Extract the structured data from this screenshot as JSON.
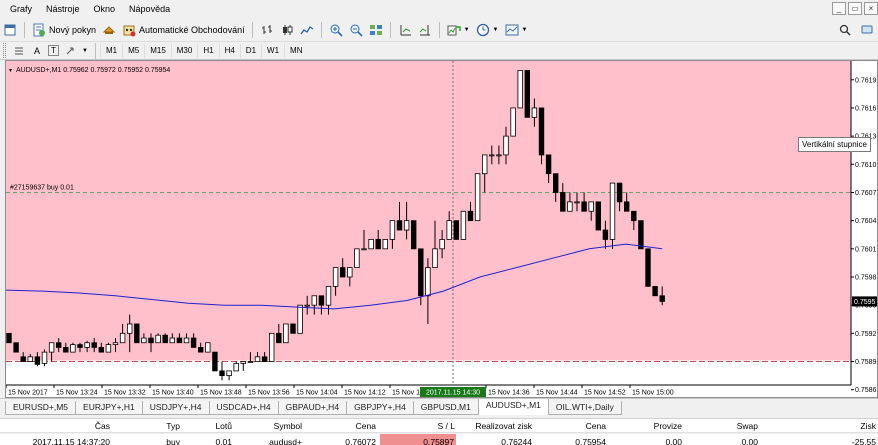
{
  "menu": [
    "Grafy",
    "Nástroje",
    "Okno",
    "Nápověda"
  ],
  "window_controls": [
    "_",
    "▭",
    "×"
  ],
  "toolbar": {
    "new_order_label": "Nový pokyn",
    "autotrading_label": "Automatické Obchodování"
  },
  "timeframes": [
    "M1",
    "M5",
    "M15",
    "M30",
    "H1",
    "H4",
    "D1",
    "W1",
    "MN"
  ],
  "draw_tools": [
    "A",
    "T"
  ],
  "chart": {
    "header": "AUDUSD+,M1  0.75962 0.75972 0.75952 0.75954",
    "order_label": "#27159637 buy 0.01",
    "current_price_label": "0.7595",
    "crosshair_time": "2017.11.15 14:30",
    "tooltip": "Vertikální stupnice",
    "background_color": "#ffc0cb",
    "ma_color": "#2020d0",
    "bull_color": "#ffffff",
    "bear_color": "#000000"
  },
  "chart_data": {
    "type": "candlestick",
    "title": "",
    "symbol": "AUDUSD+",
    "timeframe": "M1",
    "ylim": [
      0.75865,
      0.7621
    ],
    "y_ticks": [
      "0.7619",
      "0.7616",
      "0.7613",
      "0.7610",
      "0.7607",
      "0.7604",
      "0.7601",
      "0.7598",
      "0.7595",
      "0.7592",
      "0.7589",
      "0.7586"
    ],
    "x_ticks": [
      "15 Nov 2017",
      "15 Nov 13:24",
      "15 Nov 13:32",
      "15 Nov 13:40",
      "15 Nov 13:48",
      "15 Nov 13:56",
      "15 Nov 14:04",
      "15 Nov 14:12",
      "15 Nov 14",
      "15 Nov 14:36",
      "15 Nov 14:44",
      "15 Nov 14:52",
      "15 Nov 15:00"
    ],
    "order_line_price": 0.7607,
    "stop_line_price": 0.7589,
    "candles": [
      [
        0.7592,
        0.7592,
        0.7591,
        0.7591
      ],
      [
        0.7591,
        0.7591,
        0.759,
        0.759
      ],
      [
        0.75895,
        0.759,
        0.7589,
        0.7589
      ],
      [
        0.7589,
        0.75898,
        0.7589,
        0.75895
      ],
      [
        0.75895,
        0.759,
        0.75885,
        0.75887
      ],
      [
        0.75888,
        0.75903,
        0.75885,
        0.759
      ],
      [
        0.759,
        0.7591,
        0.7589,
        0.7591
      ],
      [
        0.7591,
        0.75915,
        0.759,
        0.75905
      ],
      [
        0.75905,
        0.7591,
        0.759,
        0.759
      ],
      [
        0.759,
        0.7591,
        0.759,
        0.75908
      ],
      [
        0.75908,
        0.7591,
        0.759,
        0.75905
      ],
      [
        0.75905,
        0.75912,
        0.759,
        0.7591
      ],
      [
        0.7591,
        0.75915,
        0.759,
        0.75905
      ],
      [
        0.75905,
        0.7591,
        0.759,
        0.759
      ],
      [
        0.759,
        0.7591,
        0.759,
        0.75908
      ],
      [
        0.75908,
        0.75915,
        0.759,
        0.7591
      ],
      [
        0.7591,
        0.7593,
        0.7591,
        0.7592
      ],
      [
        0.7592,
        0.7594,
        0.759,
        0.7593
      ],
      [
        0.7593,
        0.7593,
        0.7591,
        0.7591
      ],
      [
        0.7591,
        0.7592,
        0.7591,
        0.75915
      ],
      [
        0.75915,
        0.7592,
        0.759,
        0.7591
      ],
      [
        0.7591,
        0.7592,
        0.7591,
        0.75918
      ],
      [
        0.75918,
        0.7592,
        0.7591,
        0.7591
      ],
      [
        0.7591,
        0.7592,
        0.7591,
        0.75915
      ],
      [
        0.75915,
        0.7592,
        0.7591,
        0.7591
      ],
      [
        0.7591,
        0.7592,
        0.7591,
        0.75915
      ],
      [
        0.75915,
        0.7592,
        0.75905,
        0.75905
      ],
      [
        0.75905,
        0.7591,
        0.759,
        0.759
      ],
      [
        0.759,
        0.7591,
        0.759,
        0.7591
      ],
      [
        0.759,
        0.759,
        0.7588,
        0.7588
      ],
      [
        0.7588,
        0.7589,
        0.7587,
        0.75875
      ],
      [
        0.75875,
        0.7588,
        0.7587,
        0.7588
      ],
      [
        0.7588,
        0.7589,
        0.7588,
        0.75888
      ],
      [
        0.75888,
        0.7589,
        0.7588,
        0.7589
      ],
      [
        0.7589,
        0.759,
        0.7589,
        0.7589
      ],
      [
        0.7589,
        0.759,
        0.7589,
        0.75895
      ],
      [
        0.75895,
        0.759,
        0.7589,
        0.7589
      ],
      [
        0.7589,
        0.7592,
        0.7589,
        0.7592
      ],
      [
        0.7592,
        0.7593,
        0.7591,
        0.7591
      ],
      [
        0.7591,
        0.7593,
        0.7591,
        0.7593
      ],
      [
        0.7593,
        0.7593,
        0.7592,
        0.7592
      ],
      [
        0.7592,
        0.7595,
        0.7592,
        0.7595
      ],
      [
        0.7595,
        0.7596,
        0.7594,
        0.7595
      ],
      [
        0.7595,
        0.7596,
        0.7594,
        0.7596
      ],
      [
        0.7596,
        0.7596,
        0.7594,
        0.7595
      ],
      [
        0.7595,
        0.7597,
        0.7594,
        0.7597
      ],
      [
        0.7597,
        0.7599,
        0.7596,
        0.7599
      ],
      [
        0.7599,
        0.76,
        0.7598,
        0.7598
      ],
      [
        0.7598,
        0.7599,
        0.7597,
        0.7599
      ],
      [
        0.7599,
        0.7601,
        0.7599,
        0.7601
      ],
      [
        0.7601,
        0.7603,
        0.7601,
        0.7601
      ],
      [
        0.7601,
        0.7602,
        0.7601,
        0.7602
      ],
      [
        0.7602,
        0.7603,
        0.7601,
        0.7601
      ],
      [
        0.7601,
        0.7602,
        0.7601,
        0.7602
      ],
      [
        0.7602,
        0.7604,
        0.7601,
        0.7604
      ],
      [
        0.7604,
        0.7606,
        0.7603,
        0.7603
      ],
      [
        0.7603,
        0.7606,
        0.7602,
        0.7604
      ],
      [
        0.7604,
        0.7604,
        0.7601,
        0.7601
      ],
      [
        0.7601,
        0.7601,
        0.7595,
        0.7596
      ],
      [
        0.7596,
        0.76,
        0.7593,
        0.7599
      ],
      [
        0.7599,
        0.7604,
        0.7599,
        0.7601
      ],
      [
        0.7601,
        0.7603,
        0.76,
        0.7602
      ],
      [
        0.7602,
        0.7605,
        0.7602,
        0.7604
      ],
      [
        0.7604,
        0.7604,
        0.7602,
        0.7602
      ],
      [
        0.7602,
        0.7605,
        0.7602,
        0.7605
      ],
      [
        0.7605,
        0.7606,
        0.7604,
        0.7604
      ],
      [
        0.7604,
        0.7609,
        0.7604,
        0.7609
      ],
      [
        0.7609,
        0.7611,
        0.7607,
        0.7611
      ],
      [
        0.7611,
        0.7612,
        0.761,
        0.7611
      ],
      [
        0.7611,
        0.7612,
        0.761,
        0.7611
      ],
      [
        0.7611,
        0.7614,
        0.761,
        0.7613
      ],
      [
        0.7613,
        0.7616,
        0.7613,
        0.7616
      ],
      [
        0.7616,
        0.762,
        0.7616,
        0.762
      ],
      [
        0.762,
        0.762,
        0.7615,
        0.7615
      ],
      [
        0.7615,
        0.7617,
        0.7614,
        0.7616
      ],
      [
        0.7616,
        0.7616,
        0.761,
        0.7611
      ],
      [
        0.7611,
        0.7611,
        0.7608,
        0.7609
      ],
      [
        0.7609,
        0.7609,
        0.7606,
        0.7607
      ],
      [
        0.7607,
        0.7608,
        0.7605,
        0.7605
      ],
      [
        0.7605,
        0.7607,
        0.7605,
        0.7606
      ],
      [
        0.7606,
        0.7607,
        0.7605,
        0.7606
      ],
      [
        0.7606,
        0.7607,
        0.7605,
        0.7605
      ],
      [
        0.7605,
        0.7606,
        0.7604,
        0.7606
      ],
      [
        0.7606,
        0.7606,
        0.7603,
        0.7603
      ],
      [
        0.7603,
        0.7604,
        0.7601,
        0.7602
      ],
      [
        0.7602,
        0.7608,
        0.7601,
        0.7608
      ],
      [
        0.7608,
        0.7608,
        0.7605,
        0.7606
      ],
      [
        0.7606,
        0.7607,
        0.7605,
        0.7605
      ],
      [
        0.7605,
        0.7605,
        0.7603,
        0.7604
      ],
      [
        0.7604,
        0.7604,
        0.7601,
        0.7601
      ],
      [
        0.7601,
        0.7601,
        0.7597,
        0.7597
      ],
      [
        0.7597,
        0.7597,
        0.7596,
        0.7596
      ],
      [
        0.7596,
        0.7597,
        0.7595,
        0.75954
      ]
    ],
    "ma": [
      0.75966,
      0.75965,
      0.75963,
      0.7596,
      0.75956,
      0.75952,
      0.7595,
      0.7595,
      0.75948,
      0.75946,
      0.7595,
      0.75955,
      0.75965,
      0.7598,
      0.7599,
      0.76,
      0.7601,
      0.76015,
      0.7601
    ]
  },
  "tabs": [
    {
      "label": "EURUSD+,M5",
      "active": false
    },
    {
      "label": "EURJPY+,H1",
      "active": false
    },
    {
      "label": "USDJPY+,H4",
      "active": false
    },
    {
      "label": "USDCAD+,H4",
      "active": false
    },
    {
      "label": "GBPAUD+,H4",
      "active": false
    },
    {
      "label": "GBPJPY+,H4",
      "active": false
    },
    {
      "label": "GBPUSD,M1",
      "active": false
    },
    {
      "label": "AUDUSD+,M1",
      "active": true
    },
    {
      "label": "OIL.WTI+,Daily",
      "active": false
    }
  ],
  "trade_table": {
    "headers": [
      "Čas",
      "Typ",
      "Lotů",
      "Symbol",
      "Cena",
      "S / L",
      "Realizovat zisk",
      "Cena",
      "Provize",
      "Swap",
      "Zisk"
    ],
    "row": [
      "2017.11.15 14:37:20",
      "buy",
      "0.01",
      "audusd+",
      "0.76072",
      "0.75897",
      "0.76244",
      "0.75954",
      "0.00",
      "0.00",
      "-25.55"
    ]
  }
}
